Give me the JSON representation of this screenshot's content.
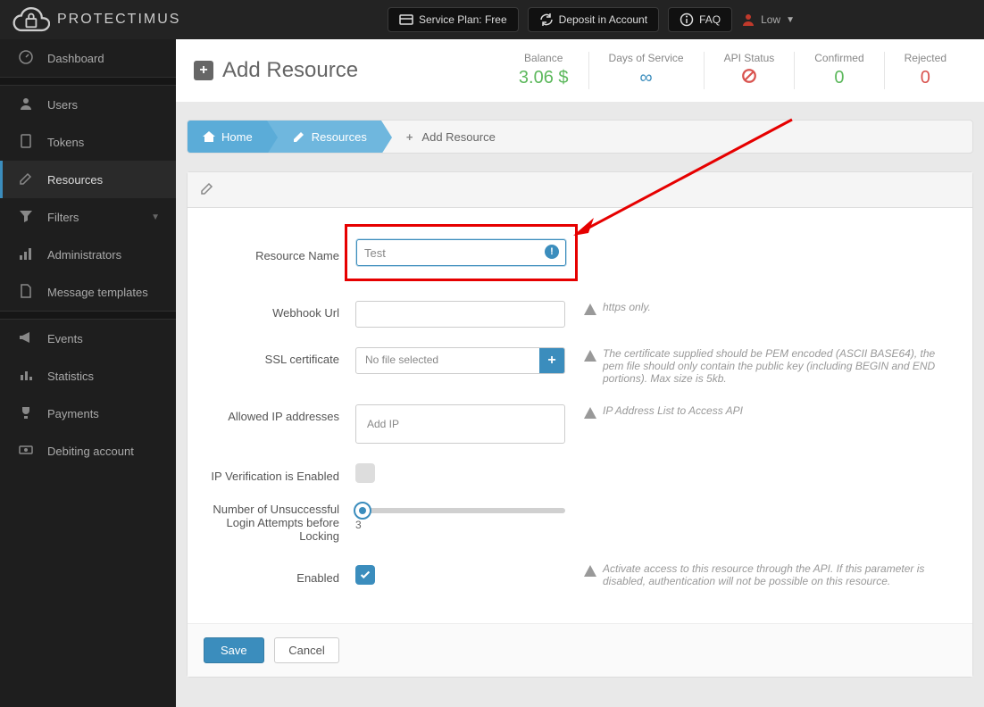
{
  "brand": "PROTECTIMUS",
  "topbar": {
    "service_plan": "Service Plan: Free",
    "deposit": "Deposit in Account",
    "faq": "FAQ",
    "user": "Low"
  },
  "sidebar": {
    "dashboard": "Dashboard",
    "users": "Users",
    "tokens": "Tokens",
    "resources": "Resources",
    "filters": "Filters",
    "administrators": "Administrators",
    "message_templates": "Message templates",
    "events": "Events",
    "statistics": "Statistics",
    "payments": "Payments",
    "debiting": "Debiting account"
  },
  "page": {
    "title": "Add Resource"
  },
  "stats": {
    "balance_label": "Balance",
    "balance_value": "3.06 $",
    "days_label": "Days of Service",
    "days_value": "∞",
    "api_label": "API Status",
    "confirmed_label": "Confirmed",
    "confirmed_value": "0",
    "rejected_label": "Rejected",
    "rejected_value": "0"
  },
  "breadcrumb": {
    "home": "Home",
    "resources": "Resources",
    "add": "Add Resource"
  },
  "form": {
    "resource_name_label": "Resource Name",
    "resource_name_value": "Test",
    "webhook_label": "Webhook Url",
    "webhook_help": "https only.",
    "ssl_label": "SSL certificate",
    "ssl_file_text": "No file selected",
    "ssl_help": "The certificate supplied should be PEM encoded (ASCII BASE64), the pem file should only contain the public key (including BEGIN and END portions). Max size is 5kb.",
    "ip_label": "Allowed IP addresses",
    "ip_placeholder": "Add IP",
    "ip_help": "IP Address List to Access API",
    "ipverify_label": "IP Verification is Enabled",
    "attempts_label": "Number of Unsuccessful Login Attempts before Locking",
    "attempts_value": "3",
    "enabled_label": "Enabled",
    "enabled_help": "Activate access to this resource through the API. If this parameter is disabled, authentication will not be possible on this resource.",
    "save": "Save",
    "cancel": "Cancel"
  }
}
